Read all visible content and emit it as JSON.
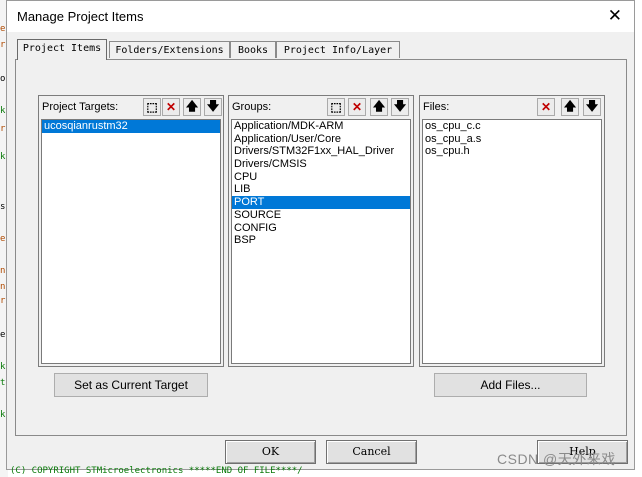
{
  "window": {
    "title": "Manage Project Items",
    "close_glyph": "✕"
  },
  "tabs": [
    {
      "label": "Project Items"
    },
    {
      "label": "Folders/Extensions"
    },
    {
      "label": "Books"
    },
    {
      "label": "Project Info/Layer"
    }
  ],
  "targets": {
    "title": "Project Targets:",
    "items": [
      "ucosqianrustm32"
    ],
    "selected_index": 0,
    "set_current_label": "Set as Current Target"
  },
  "groups": {
    "title": "Groups:",
    "items": [
      "Application/MDK-ARM",
      "Application/User/Core",
      "Drivers/STM32F1xx_HAL_Driver",
      "Drivers/CMSIS",
      "CPU",
      "LIB",
      "PORT",
      "SOURCE",
      "CONFIG",
      "BSP"
    ],
    "selected_index": 6
  },
  "files": {
    "title": "Files:",
    "items": [
      "os_cpu_c.c",
      "os_cpu_a.s",
      "os_cpu.h"
    ],
    "add_files_label": "Add Files..."
  },
  "toolbar_glyphs": {
    "new": "⬚",
    "delete": "✕",
    "up": "🡅",
    "down": "🡇"
  },
  "footer": {
    "ok_label": "OK",
    "cancel_label": "Cancel",
    "help_label": "Help"
  },
  "background": {
    "bottom_text": "(C) COPYRIGHT STMicroelectronics *****END OF FILE****/",
    "watermark": "CSDN @天外来戏"
  },
  "colors": {
    "selection": "#0078d7",
    "delete_icon": "#c00000",
    "dialog_bg": "#f0f0f0"
  }
}
